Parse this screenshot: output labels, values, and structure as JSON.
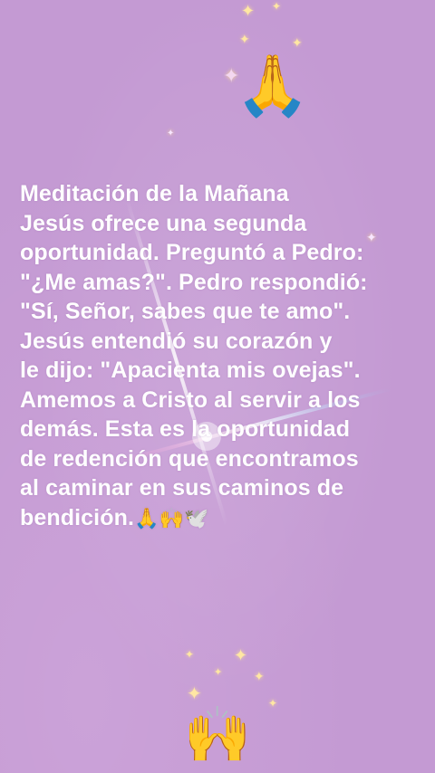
{
  "header": {
    "top_emoji": "🙏"
  },
  "message": {
    "lines": [
      "Meditación de la Mañana",
      "Jesús ofrece una segunda",
      "oportunidad. Preguntó a Pedro:",
      "\"¿Me amas?\". Pedro respondió:",
      "\"Sí, Señor, sabes que te amo\".",
      "Jesús entendió su corazón y",
      "le dijo: \"Apacienta mis ovejas\".",
      "Amemos a Cristo al servir a los",
      "demás. Esta es la oportunidad",
      "de redención que encontramos",
      "al caminar en sus caminos de",
      "bendición."
    ],
    "trailing_emojis": "🙏🙌🕊️"
  },
  "footer": {
    "bottom_emoji": "🙌"
  },
  "colors": {
    "background": "#c49ad3",
    "text": "#ffffff",
    "sparkle": "#ffe7a3"
  }
}
